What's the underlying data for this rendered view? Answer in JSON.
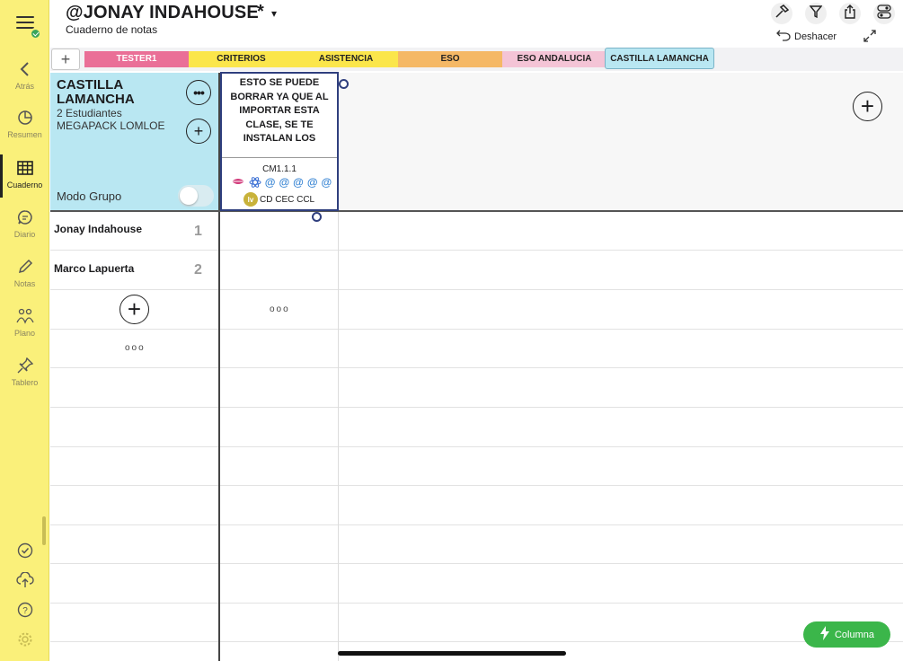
{
  "header": {
    "title": "@JONAY INDAHOUSE",
    "unsaved_mark": "*",
    "dropdown_caret": "▾",
    "subtitle": "Cuaderno de notas",
    "undo_label": "Deshacer"
  },
  "sidebar": {
    "items": [
      {
        "label": "Atrás",
        "icon": "back-arrow-icon"
      },
      {
        "label": "Resumen",
        "icon": "pie-chart-icon"
      },
      {
        "label": "Cuaderno",
        "icon": "grid-icon"
      },
      {
        "label": "Diario",
        "icon": "chat-icon"
      },
      {
        "label": "Notas",
        "icon": "pencil-icon"
      },
      {
        "label": "Plano",
        "icon": "people-icon"
      },
      {
        "label": "Tablero",
        "icon": "pin-icon"
      }
    ]
  },
  "tabs": [
    {
      "label": "TESTER1",
      "color": "#ea6f97",
      "text_color": "#ffffff"
    },
    {
      "label": "CRITERIOS",
      "color": "#fbe64b",
      "text_color": "#222222"
    },
    {
      "label": "ASISTENCIA",
      "color": "#fbe64b",
      "text_color": "#222222"
    },
    {
      "label": "ESO",
      "color": "#f5b866",
      "text_color": "#222222"
    },
    {
      "label": "ESO ANDALUCIA",
      "color": "#f4c4d6",
      "text_color": "#222222"
    },
    {
      "label": "CASTILLA LAMANCHA",
      "color": "#b9e7f2",
      "text_color": "#222222",
      "active": true
    }
  ],
  "class_card": {
    "name": "CASTILLA LAMANCHA",
    "students_count": "2 Estudiantes",
    "pack": "MEGAPACK LOMLOE",
    "group_mode_label": "Modo Grupo",
    "group_mode_on": false
  },
  "column": {
    "title": "ESTO SE PUEDE BORRAR YA QUE AL IMPORTAR ESTA CLASE, SE TE INSTALAN LOS",
    "code": "CM1.1.1",
    "icons": [
      "lips-icon",
      "atom-icon",
      "@",
      "@",
      "@",
      "@",
      "@"
    ],
    "level_badge": "lv",
    "competences": "CD CEC CCL"
  },
  "students": [
    {
      "name": "Jonay  Indahouse",
      "number": "1"
    },
    {
      "name": "Marco Lapuerta",
      "number": "2"
    }
  ],
  "more_dots": "ooo",
  "fab_label": "Columna",
  "colors": {
    "sidebar": "#faf07a",
    "class_card": "#b9e7f2",
    "column_border": "#2f3f7e",
    "fab": "#3bb64a"
  }
}
